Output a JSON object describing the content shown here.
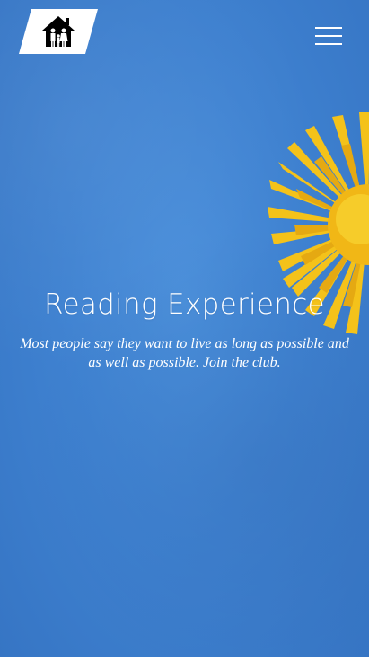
{
  "header": {
    "logo_icon": "family-house-icon",
    "menu_icon": "hamburger-menu-icon"
  },
  "hero": {
    "title": "Reading Experience",
    "subtitle": "Most people say they want to live as long as possible and as well as possible. Join the club."
  },
  "colors": {
    "sky": "#3f82d1",
    "flower": "#f5c21b",
    "text": "#ffffff"
  }
}
